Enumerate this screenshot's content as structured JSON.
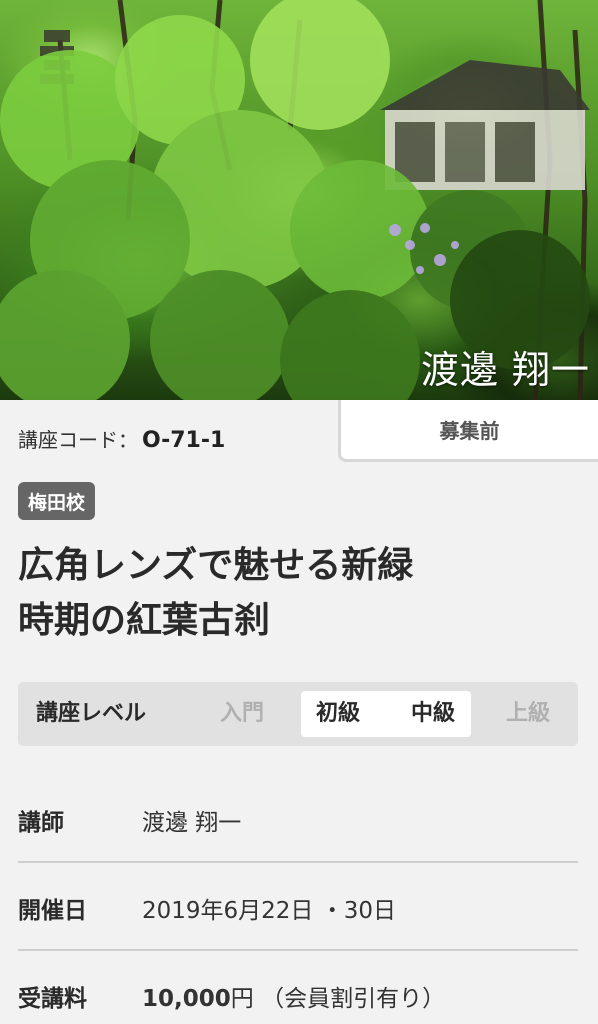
{
  "hero": {
    "author_caption": "渡邊 翔一"
  },
  "course": {
    "code_label": "講座コード",
    "code_separator": "：",
    "code_value": "O-71-1",
    "status": "募集前",
    "campus": "梅田校",
    "title_line1": "広角レンズで魅せる新緑",
    "title_line2": "時期の紅葉古刹"
  },
  "level": {
    "label": "講座レベル",
    "options": [
      "入門",
      "初級",
      "中級",
      "上級"
    ],
    "active": [
      "初級",
      "中級"
    ]
  },
  "details": {
    "instructor_key": "講師",
    "instructor_value": "渡邊 翔一",
    "date_key": "開催日",
    "date_value": "2019年6月22日 ・30日",
    "fee_key": "受講料",
    "fee_amount": "10,000",
    "fee_unit": "円",
    "fee_note": "（会員割引有り）"
  },
  "colors": {
    "background": "#f2f2f2",
    "badge": "#666666",
    "level_bar": "#e1e1e1",
    "level_inactive": "#b0b0b0"
  }
}
